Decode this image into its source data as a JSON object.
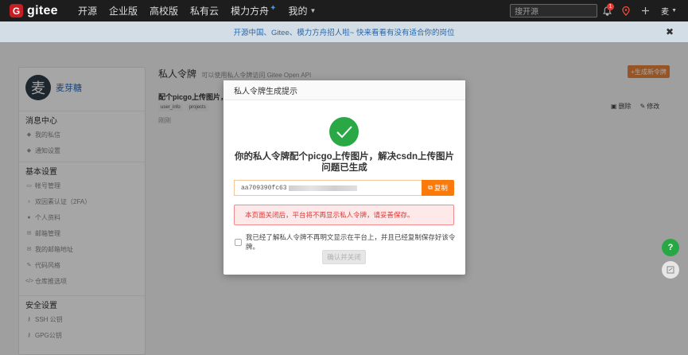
{
  "navbar": {
    "logo_mark": "G",
    "logo_text": "gitee",
    "links": {
      "open_source": "开源",
      "enterprise": "企业版",
      "university": "高校版",
      "private_cloud": "私有云",
      "mali": "模力方舟",
      "mine": "我的"
    },
    "search_placeholder": "搜开源",
    "notification_count": "1",
    "user_label": "麦"
  },
  "banner": {
    "text": "开源中国、Gitee、模力方舟招人啦~ 快来看看有没有适合你的岗位",
    "close": "✖"
  },
  "sidebar": {
    "avatar_char": "麦",
    "username": "麦芽糖",
    "sections": {
      "messages": "消息中心",
      "basic": "基本设置",
      "security": "安全设置"
    },
    "message_items": [
      "我的私信",
      "通知设置"
    ],
    "basic_items": [
      "帐号管理",
      "双因素认证（2FA）",
      "个人资料",
      "邮箱管理",
      "我的邮箱地址",
      "代码风格",
      "仓库推选项"
    ],
    "security_items": [
      "SSH 公钥",
      "GPG公钥"
    ]
  },
  "main": {
    "title": "私人令牌",
    "subtitle": "可以使用私人令牌访问 Gitee Open API",
    "create_button": "+生成新令牌",
    "token_name": "配个picgo上传图片，",
    "tags": [
      "user_info",
      "projects"
    ],
    "status": "刚刚",
    "delete": "删除",
    "edit": "修改"
  },
  "modal": {
    "title": "私人令牌生成提示",
    "message": "你的私人令牌配个picgo上传图片，解决csdn上传图片问题已生成",
    "token_prefix": "aa709390fc63",
    "copy_button": "复制",
    "warning": "本页面关闭后，平台将不再显示私人令牌，请妥善保存。",
    "confirm_text": "我已经了解私人令牌不再明文显示在平台上，并且已经复制保存好该令牌。",
    "close_button": "确认并关闭"
  },
  "floating": {
    "help": "?"
  },
  "colors": {
    "brand_red": "#c71d23",
    "success_green": "#2aa845",
    "copy_orange": "#fa7a0b",
    "warning_red": "#d83b3b",
    "link_blue": "#2c6db5"
  }
}
